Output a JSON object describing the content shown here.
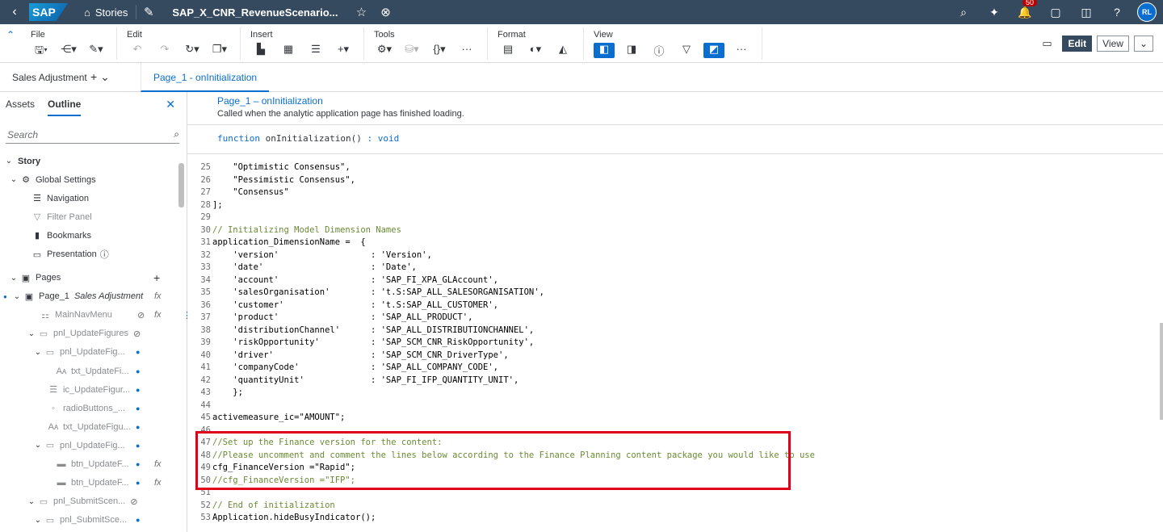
{
  "shell": {
    "back": "‹",
    "logo": "SAP",
    "breadcrumb": "Stories",
    "title": "SAP_X_CNR_RevenueScenario...",
    "notification_count": "50",
    "avatar": "RL"
  },
  "toolbar": {
    "groups": {
      "file": "File",
      "edit": "Edit",
      "insert": "Insert",
      "tools": "Tools",
      "format": "Format",
      "view": "View"
    },
    "modes": {
      "edit": "Edit",
      "view": "View"
    }
  },
  "tabbar": {
    "story_name": "Sales Adjustment",
    "page_tab": "Page_1 - onInitialization"
  },
  "left_panel": {
    "tabs": [
      "Assets",
      "Outline"
    ],
    "search_placeholder": "Search",
    "tree": {
      "story": "Story",
      "global_settings": "Global Settings",
      "navigation": "Navigation",
      "filter_panel": "Filter Panel",
      "bookmarks": "Bookmarks",
      "presentation": "Presentation",
      "pages": "Pages",
      "page_1": "Page_1",
      "page_1_sub": "Sales Adjustment",
      "main_nav_menu": "MainNavMenu",
      "pnl_update_figures": "pnl_UpdateFigures",
      "pnl_update_fig_1": "pnl_UpdateFig...",
      "txt_update_fi": "txt_UpdateFi...",
      "ic_update_figur": "ic_UpdateFigur...",
      "radio_buttons": "radioButtons_...",
      "txt_update_figu": "txt_UpdateFigu...",
      "pnl_update_fig_2": "pnl_UpdateFig...",
      "btn_update_f_1": "btn_UpdateF...",
      "btn_update_f_2": "btn_UpdateF...",
      "pnl_submit_scen": "pnl_SubmitScen...",
      "pnl_submit_sce": "pnl_SubmitSce..."
    }
  },
  "editor": {
    "event_title": "Page_1 – onInitialization",
    "event_description": "Called when the analytic application page has finished loading.",
    "signature_keyword": "function",
    "signature_name": "onInitialization()",
    "signature_return": ": void",
    "lines": [
      {
        "n": "25",
        "t": "    \"Optimistic Consensus\","
      },
      {
        "n": "26",
        "t": "    \"Pessimistic Consensus\","
      },
      {
        "n": "27",
        "t": "    \"Consensus\""
      },
      {
        "n": "28",
        "t": "];"
      },
      {
        "n": "29",
        "t": ""
      },
      {
        "n": "30",
        "t": "// Initializing Model Dimension Names"
      },
      {
        "n": "31",
        "t": "application_DimensionName =  {"
      },
      {
        "n": "32",
        "t": "    'version'                  : 'Version',"
      },
      {
        "n": "33",
        "t": "    'date'                     : 'Date',"
      },
      {
        "n": "34",
        "t": "    'account'                  : 'SAP_FI_XPA_GLAccount',"
      },
      {
        "n": "35",
        "t": "    'salesOrganisation'        : 't.S:SAP_ALL_SALESORGANISATION',"
      },
      {
        "n": "36",
        "t": "    'customer'                 : 't.S:SAP_ALL_CUSTOMER',"
      },
      {
        "n": "37",
        "t": "    'product'                  : 'SAP_ALL_PRODUCT',"
      },
      {
        "n": "38",
        "t": "    'distributionChannel'      : 'SAP_ALL_DISTRIBUTIONCHANNEL',"
      },
      {
        "n": "39",
        "t": "    'riskOpportunity'          : 'SAP_SCM_CNR_RiskOpportunity',"
      },
      {
        "n": "40",
        "t": "    'driver'                   : 'SAP_SCM_CNR_DriverType',"
      },
      {
        "n": "41",
        "t": "    'companyCode'              : 'SAP_ALL_COMPANY_CODE',"
      },
      {
        "n": "42",
        "t": "    'quantityUnit'             : 'SAP_FI_IFP_QUANTITY_UNIT',"
      },
      {
        "n": "43",
        "t": "    };"
      },
      {
        "n": "44",
        "t": ""
      },
      {
        "n": "45",
        "t": "activemeasure_ic=\"AMOUNT\";"
      },
      {
        "n": "46",
        "t": ""
      },
      {
        "n": "47",
        "t": "//Set up the Finance version for the content:"
      },
      {
        "n": "48",
        "t": "//Please uncomment and comment the lines below according to the Finance Planning content package you would like to use"
      },
      {
        "n": "49",
        "t": "cfg_FinanceVersion =\"Rapid\";"
      },
      {
        "n": "50",
        "t": "//cfg_FinanceVersion =\"IFP\";"
      },
      {
        "n": "51",
        "t": ""
      },
      {
        "n": "52",
        "t": "// End of initialization"
      },
      {
        "n": "53",
        "t": "Application.hideBusyIndicator();"
      }
    ]
  }
}
